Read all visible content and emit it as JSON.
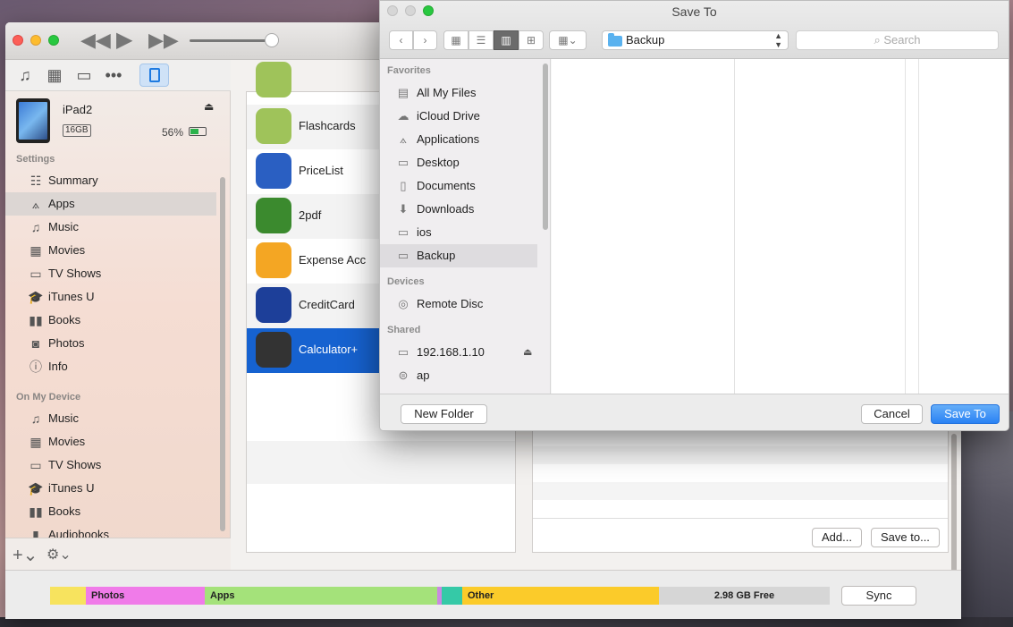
{
  "itunes": {
    "device": {
      "name": "iPad2",
      "capacity": "16GB",
      "battery": "56%"
    },
    "sidebar": {
      "settings_header": "Settings",
      "settings_items": [
        {
          "label": "Summary",
          "icon": "summary-icon"
        },
        {
          "label": "Apps",
          "icon": "apps-icon"
        },
        {
          "label": "Music",
          "icon": "music-icon"
        },
        {
          "label": "Movies",
          "icon": "movies-icon"
        },
        {
          "label": "TV Shows",
          "icon": "tv-icon"
        },
        {
          "label": "iTunes U",
          "icon": "itunes-u-icon"
        },
        {
          "label": "Books",
          "icon": "books-icon"
        },
        {
          "label": "Photos",
          "icon": "photos-icon"
        },
        {
          "label": "Info",
          "icon": "info-icon"
        }
      ],
      "device_header": "On My Device",
      "device_items": [
        {
          "label": "Music",
          "icon": "music-icon"
        },
        {
          "label": "Movies",
          "icon": "movies-icon"
        },
        {
          "label": "TV Shows",
          "icon": "tv-icon"
        },
        {
          "label": "iTunes U",
          "icon": "itunes-u-icon"
        },
        {
          "label": "Books",
          "icon": "books-icon"
        },
        {
          "label": "Audiobooks",
          "icon": "audiobooks-icon"
        }
      ]
    },
    "apps": [
      {
        "name": "Flashcards",
        "color": "#9fc35a"
      },
      {
        "name": "PriceList",
        "color": "#2a5fc2"
      },
      {
        "name": "2pdf",
        "color": "#3b8a2e"
      },
      {
        "name": "Expense Acc",
        "color": "#f4a623"
      },
      {
        "name": "CreditCard",
        "color": "#1d3f99"
      },
      {
        "name": "Calculator+",
        "color": "#333333"
      }
    ],
    "file_buttons": {
      "add": "Add...",
      "save_to": "Save to..."
    },
    "storage": {
      "segments": [
        {
          "label": "",
          "color": "#f7e35e",
          "fraction": 0.046
        },
        {
          "label": "Photos",
          "color": "#f07be9",
          "fraction": 0.153
        },
        {
          "label": "Apps",
          "color": "#a4e27a",
          "fraction": 0.298
        },
        {
          "label": "",
          "color": "#c98ae0",
          "fraction": 0.006
        },
        {
          "label": "",
          "color": "#35c9a7",
          "fraction": 0.026
        },
        {
          "label": "Other",
          "color": "#fbcb2a",
          "fraction": 0.252
        },
        {
          "label": "2.98 GB Free",
          "color": "#d6d6d6",
          "fraction": 0.219
        }
      ],
      "sync": "Sync"
    }
  },
  "dialog": {
    "title": "Save To",
    "location": "Backup",
    "search_placeholder": "Search",
    "favorites_header": "Favorites",
    "favorites": [
      {
        "label": "All My Files",
        "icon": "all-files-icon"
      },
      {
        "label": "iCloud Drive",
        "icon": "cloud-icon"
      },
      {
        "label": "Applications",
        "icon": "applications-icon"
      },
      {
        "label": "Desktop",
        "icon": "desktop-icon"
      },
      {
        "label": "Documents",
        "icon": "documents-icon"
      },
      {
        "label": "Downloads",
        "icon": "downloads-icon"
      },
      {
        "label": "ios",
        "icon": "folder-icon"
      },
      {
        "label": "Backup",
        "icon": "folder-icon"
      }
    ],
    "devices_header": "Devices",
    "devices": [
      {
        "label": "Remote Disc",
        "icon": "disc-icon"
      }
    ],
    "shared_header": "Shared",
    "shared": [
      {
        "label": "192.168.1.10",
        "icon": "network-computer-icon"
      },
      {
        "label": "ap",
        "icon": "network-drive-icon"
      }
    ],
    "new_folder": "New Folder",
    "cancel": "Cancel",
    "save": "Save To"
  }
}
